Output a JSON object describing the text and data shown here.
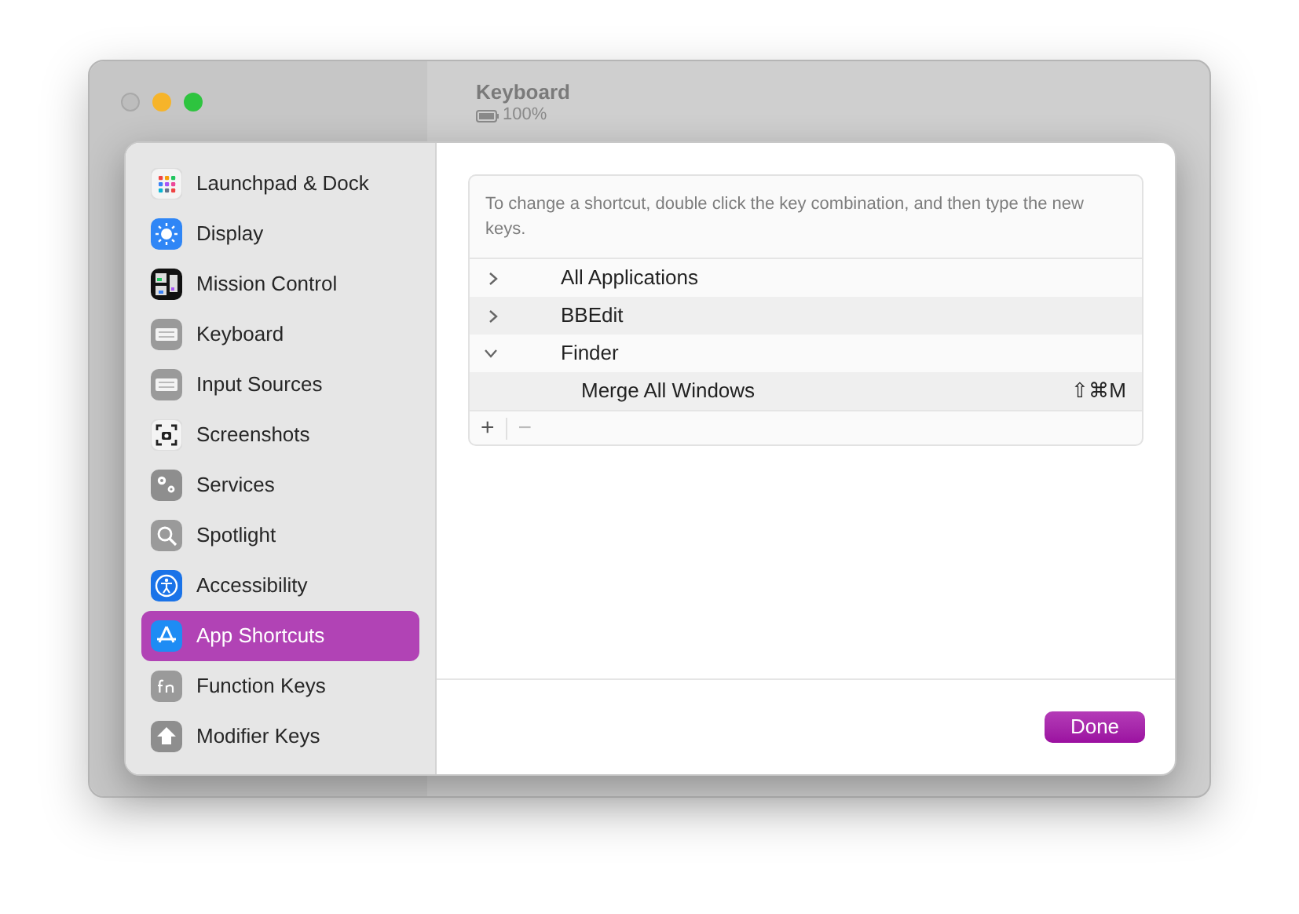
{
  "window": {
    "title": "Keyboard",
    "battery": "100%"
  },
  "sidebar": {
    "items": [
      {
        "label": "Launchpad & Dock",
        "kind": "launchpad",
        "selected": false
      },
      {
        "label": "Display",
        "kind": "display",
        "selected": false
      },
      {
        "label": "Mission Control",
        "kind": "mission",
        "selected": false
      },
      {
        "label": "Keyboard",
        "kind": "keyboard",
        "selected": false
      },
      {
        "label": "Input Sources",
        "kind": "keyboard",
        "selected": false
      },
      {
        "label": "Screenshots",
        "kind": "screenshot",
        "selected": false
      },
      {
        "label": "Services",
        "kind": "gears",
        "selected": false
      },
      {
        "label": "Spotlight",
        "kind": "search",
        "selected": false
      },
      {
        "label": "Accessibility",
        "kind": "accessibility",
        "selected": false
      },
      {
        "label": "App Shortcuts",
        "kind": "appstore",
        "selected": true
      },
      {
        "label": "Function Keys",
        "kind": "fn",
        "selected": false
      },
      {
        "label": "Modifier Keys",
        "kind": "arrow",
        "selected": false
      }
    ]
  },
  "shortcuts": {
    "hint": "To change a shortcut, double click the key combination, and then type the new keys.",
    "rows": [
      {
        "label": "All Applications",
        "expanded": false
      },
      {
        "label": "BBEdit",
        "expanded": false
      },
      {
        "label": "Finder",
        "expanded": true,
        "children": [
          {
            "label": "Merge All Windows",
            "keys": "⇧⌘M"
          }
        ]
      }
    ],
    "add": "+",
    "remove": "−"
  },
  "done_button": "Done"
}
